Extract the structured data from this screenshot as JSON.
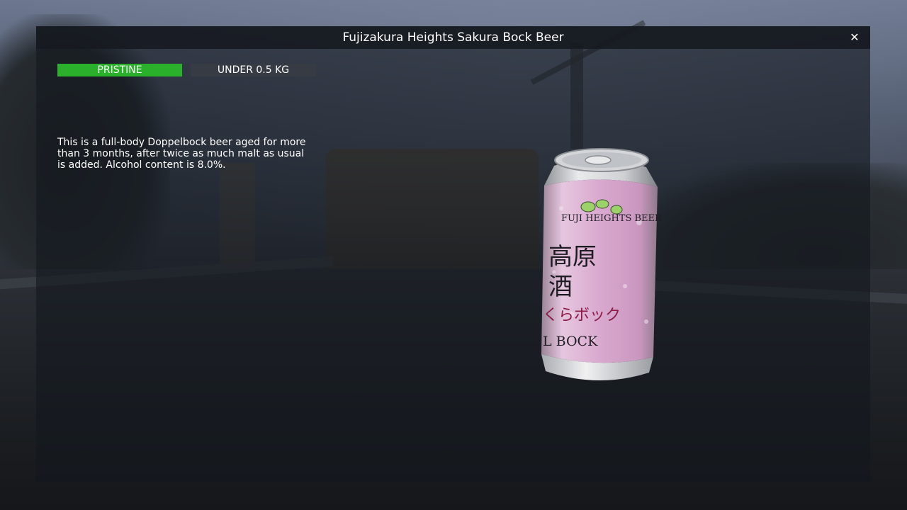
{
  "item": {
    "title": "Fujizakura Heights Sakura Bock Beer",
    "condition": "PRISTINE",
    "weight": "UNDER 0.5 KG",
    "description": "This is a full-body Doppelbock beer aged for more than 3 months, after twice as much malt as usual is added. Alcohol content is 8.0%."
  },
  "close_icon": "close-icon",
  "colors": {
    "condition_badge": "#2bb02b",
    "weight_badge": "#373c44",
    "can_pink": "#d9a9cf"
  },
  "can_label": {
    "brand": "FUJI HEIGHTS BEER",
    "kanji_top": "高原",
    "kanji_mid": "酒",
    "kana": "くらボック",
    "latin": "L BOCK"
  }
}
